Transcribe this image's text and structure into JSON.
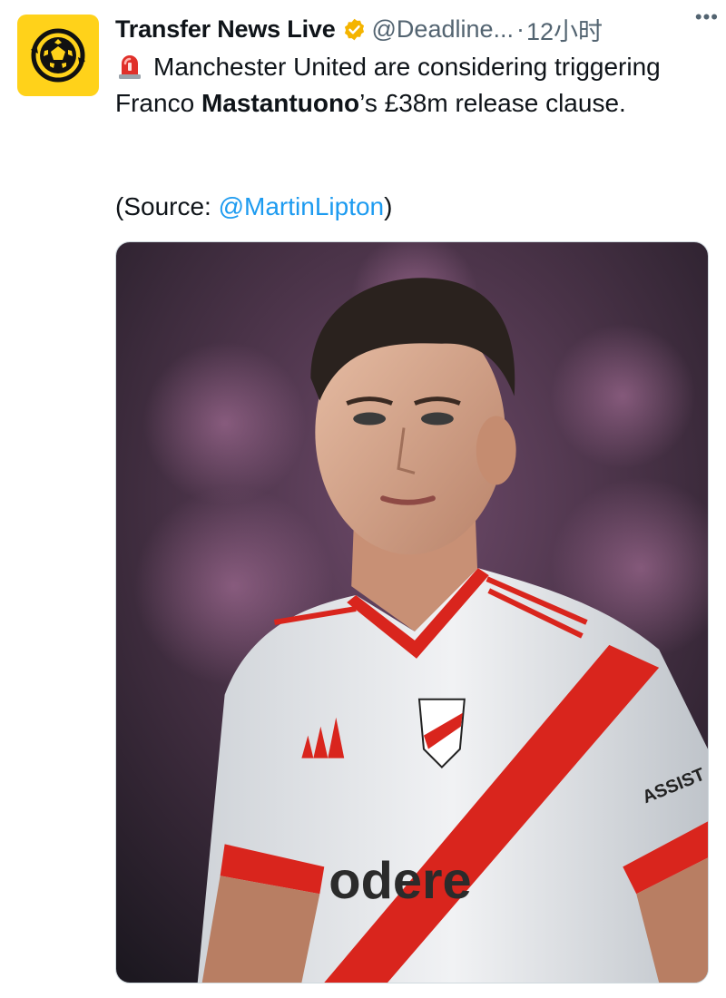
{
  "author": {
    "display_name": "Transfer News Live",
    "handle": "@Deadline...",
    "timestamp": "12小时",
    "avatar_icon": "football-logo-icon",
    "verified_icon": "verified-badge-icon",
    "verified_color": "#f4b400",
    "avatar_bg": "#ffd21a"
  },
  "tweet": {
    "siren_icon": "siren-emoji-icon",
    "text_before": "Manchester United are considering triggering Franco ",
    "text_bold": "Mastantuono",
    "text_after": "’s £38m release clause.",
    "source_prefix": "(Source: ",
    "source_mention": "@MartinLipton",
    "source_suffix": ")"
  },
  "media": {
    "description_icon": "player-photo",
    "jersey_sponsor": "odere",
    "sleeve_text": "ASSIST CAR"
  },
  "colors": {
    "link": "#1d9bf0",
    "secondary_text": "#536471",
    "jersey_red": "#d9251d"
  },
  "more_icon": "more-dots-icon"
}
